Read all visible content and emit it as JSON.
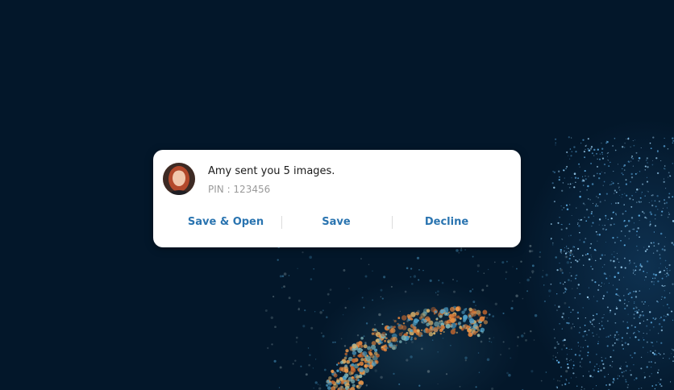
{
  "notification": {
    "message": "Amy sent you 5 images.",
    "pin": "PIN : 123456",
    "actions": [
      {
        "label": "Save & Open"
      },
      {
        "label": "Save"
      },
      {
        "label": "Decline"
      }
    ]
  },
  "icons": {
    "avatar": "user-avatar-photo"
  },
  "colors": {
    "background": "#03172a",
    "card": "#ffffff",
    "action_text": "#2a74b0",
    "secondary_text": "#9a9a9a"
  }
}
